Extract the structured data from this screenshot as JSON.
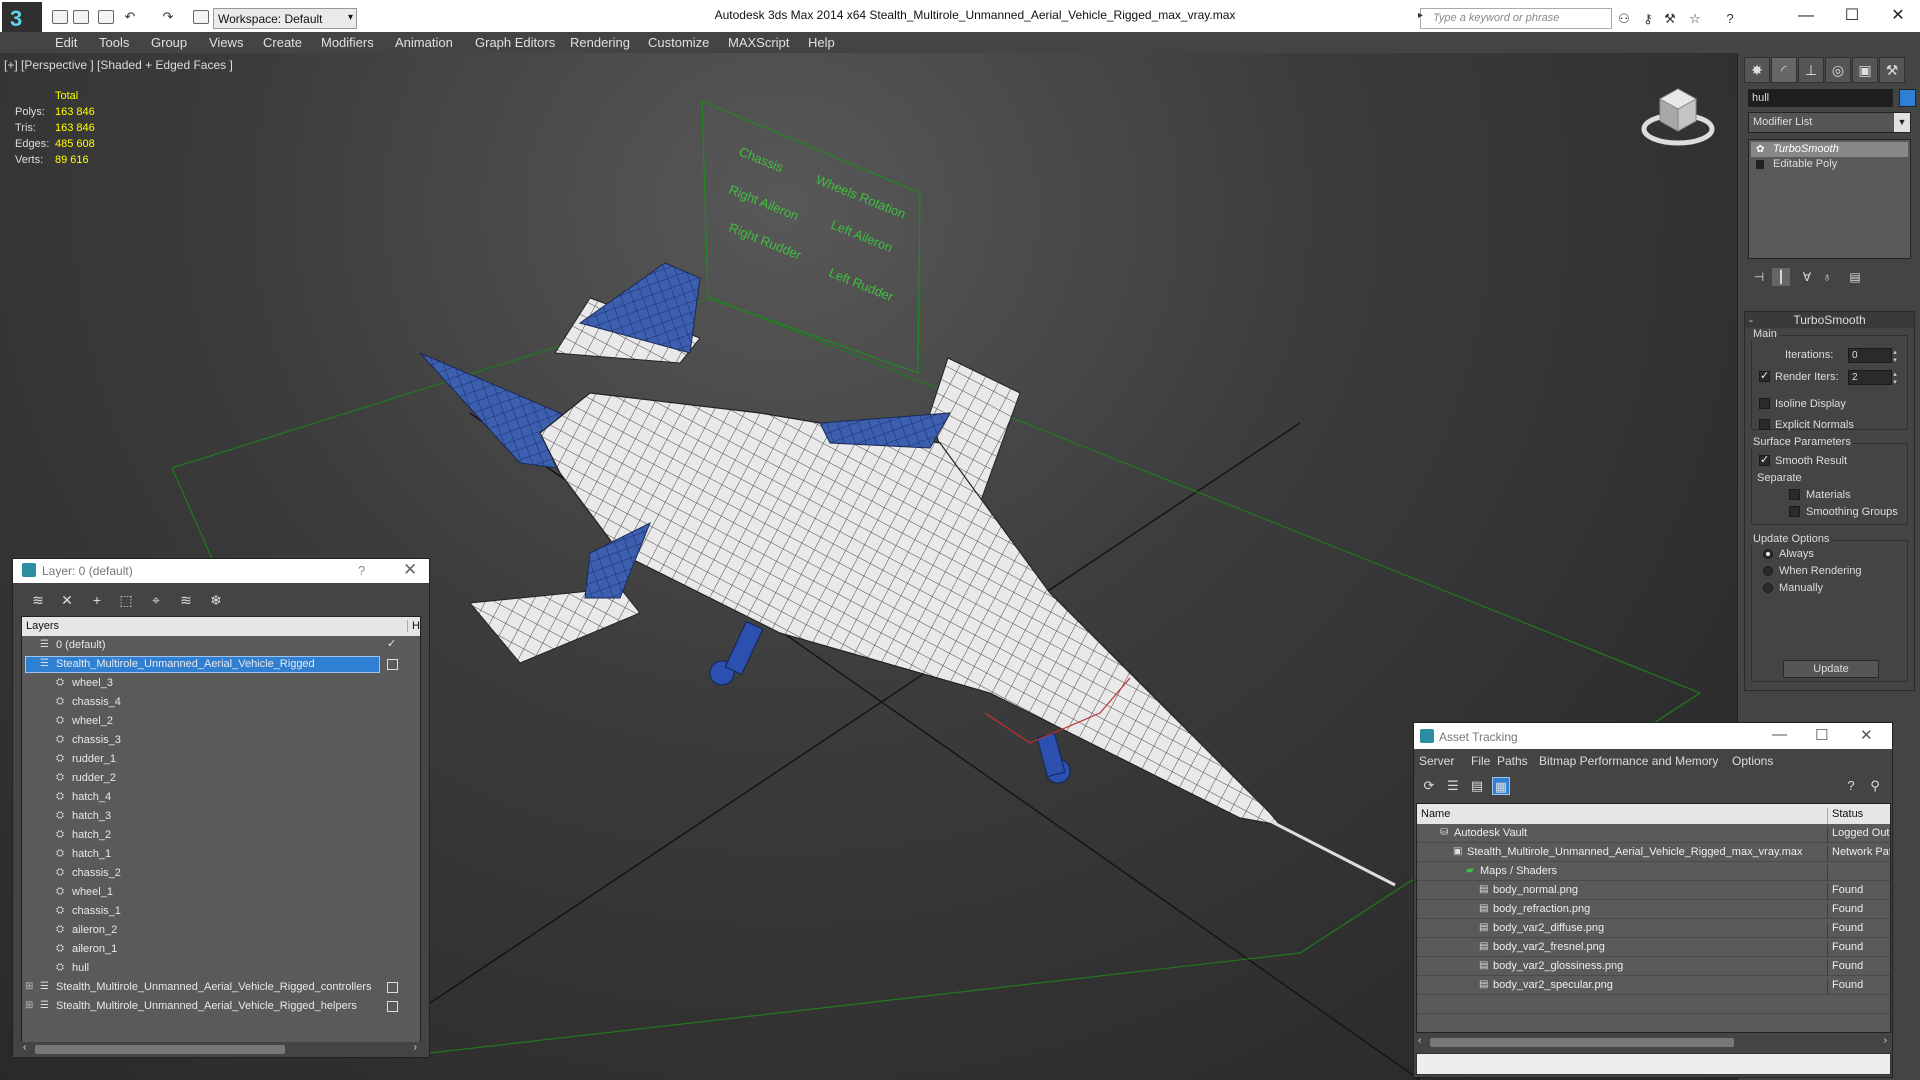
{
  "titlebar": {
    "workspace": "Workspace: Default",
    "title": "Autodesk 3ds Max  2014 x64      Stealth_Multirole_Unmanned_Aerial_Vehicle_Rigged_max_vray.max",
    "search_placeholder": "Type a keyword or phrase",
    "app_logo": "3"
  },
  "menu": [
    "Edit",
    "Tools",
    "Group",
    "Views",
    "Create",
    "Modifiers",
    "Animation",
    "Graph Editors",
    "Rendering",
    "Customize",
    "MAXScript",
    "Help"
  ],
  "viewport": {
    "label": "[+] [Perspective ] [Shaded + Edged Faces ]",
    "stats": {
      "header": "Total",
      "rows": [
        {
          "label": "Polys:",
          "value": "163 846"
        },
        {
          "label": "Tris:",
          "value": "163 846"
        },
        {
          "label": "Edges:",
          "value": "485 608"
        },
        {
          "label": "Verts:",
          "value": "89 616"
        }
      ]
    },
    "board_labels": [
      "Chassis",
      "Wheels Rotation",
      "Right Aileron",
      "Left Aileron",
      "Right Rudder",
      "Left Rudder"
    ]
  },
  "command_panel": {
    "object_name": "hull",
    "object_color": "#2f7fd3",
    "modifier_list": "Modifier List",
    "stack": [
      "TurboSmooth",
      "Editable Poly"
    ],
    "turbosmooth": {
      "title": "TurboSmooth",
      "main_label": "Main",
      "iterations_label": "Iterations:",
      "iterations_value": "0",
      "render_iters_label": "Render Iters:",
      "render_iters_value": "2",
      "isoline": "Isoline Display",
      "explicit_normals": "Explicit Normals",
      "surface_label": "Surface Parameters",
      "smooth_result": "Smooth Result",
      "separate_label": "Separate",
      "materials": "Materials",
      "smoothing_groups": "Smoothing Groups",
      "update_label": "Update Options",
      "always": "Always",
      "when_rendering": "When Rendering",
      "manually": "Manually",
      "update_button": "Update"
    }
  },
  "layer_window": {
    "title": "Layer: 0 (default)",
    "help": "?",
    "col_layers": "Layers",
    "col_hide": "H",
    "rows": [
      {
        "name": "0 (default)",
        "level": 0,
        "checked": true
      },
      {
        "name": "Stealth_Multirole_Unmanned_Aerial_Vehicle_Rigged",
        "level": 0,
        "selected": true
      },
      {
        "name": "wheel_3",
        "level": 1
      },
      {
        "name": "chassis_4",
        "level": 1
      },
      {
        "name": "wheel_2",
        "level": 1
      },
      {
        "name": "chassis_3",
        "level": 1
      },
      {
        "name": "rudder_1",
        "level": 1
      },
      {
        "name": "rudder_2",
        "level": 1
      },
      {
        "name": "hatch_4",
        "level": 1
      },
      {
        "name": "hatch_3",
        "level": 1
      },
      {
        "name": "hatch_2",
        "level": 1
      },
      {
        "name": "hatch_1",
        "level": 1
      },
      {
        "name": "chassis_2",
        "level": 1
      },
      {
        "name": "wheel_1",
        "level": 1
      },
      {
        "name": "chassis_1",
        "level": 1
      },
      {
        "name": "aileron_2",
        "level": 1
      },
      {
        "name": "aileron_1",
        "level": 1
      },
      {
        "name": "hull",
        "level": 1
      },
      {
        "name": "Stealth_Multirole_Unmanned_Aerial_Vehicle_Rigged_controllers",
        "level": 0
      },
      {
        "name": "Stealth_Multirole_Unmanned_Aerial_Vehicle_Rigged_helpers",
        "level": 0
      }
    ]
  },
  "asset_window": {
    "title": "Asset Tracking",
    "menu": [
      "Server",
      "File",
      "Paths",
      "Bitmap Performance and Memory",
      "Options"
    ],
    "col_name": "Name",
    "col_status": "Status",
    "rows": [
      {
        "name": "Autodesk Vault",
        "indent": 1,
        "status": "Logged Out"
      },
      {
        "name": "Stealth_Multirole_Unmanned_Aerial_Vehicle_Rigged_max_vray.max",
        "indent": 2,
        "status": "Network Path"
      },
      {
        "name": "Maps / Shaders",
        "indent": 3,
        "status": ""
      },
      {
        "name": "body_normal.png",
        "indent": 4,
        "status": "Found"
      },
      {
        "name": "body_refraction.png",
        "indent": 4,
        "status": "Found"
      },
      {
        "name": "body_var2_diffuse.png",
        "indent": 4,
        "status": "Found"
      },
      {
        "name": "body_var2_fresnel.png",
        "indent": 4,
        "status": "Found"
      },
      {
        "name": "body_var2_glossiness.png",
        "indent": 4,
        "status": "Found"
      },
      {
        "name": "body_var2_specular.png",
        "indent": 4,
        "status": "Found"
      }
    ]
  }
}
